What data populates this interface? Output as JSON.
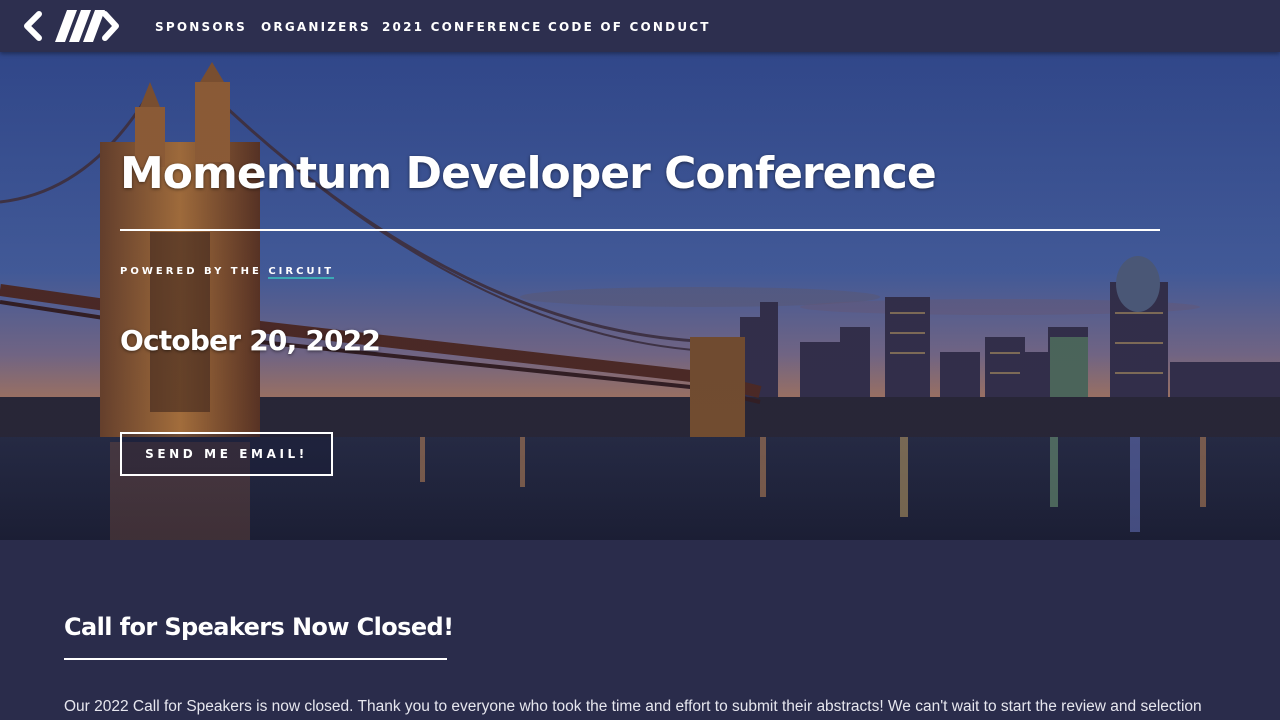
{
  "nav": {
    "logo_icon": "momentum-logo-icon",
    "links": [
      {
        "label": "SPONSORS"
      },
      {
        "label": "ORGANIZERS"
      },
      {
        "label": "2021 CONFERENCE"
      },
      {
        "label": "CODE OF CONDUCT"
      }
    ]
  },
  "hero": {
    "title": "Momentum Developer Conference",
    "powered_prefix": "POWERED BY THE",
    "powered_link": "CIRCUIT",
    "date": "October 20, 2022",
    "cta_label": "SEND ME EMAIL!",
    "background_image": "cincinnati-skyline-bridge-at-dusk"
  },
  "speakers": {
    "title": "Call for Speakers Now Closed!",
    "body": "Our 2022 Call for Speakers is now closed. Thank you to everyone who took the time and effort to submit their abstracts! We can't wait to start the review and selection"
  },
  "colors": {
    "nav_bg": "#2d2f4f",
    "page_bg": "#2a2c4b",
    "accent": "#3ba9b5",
    "text": "#ffffff"
  }
}
